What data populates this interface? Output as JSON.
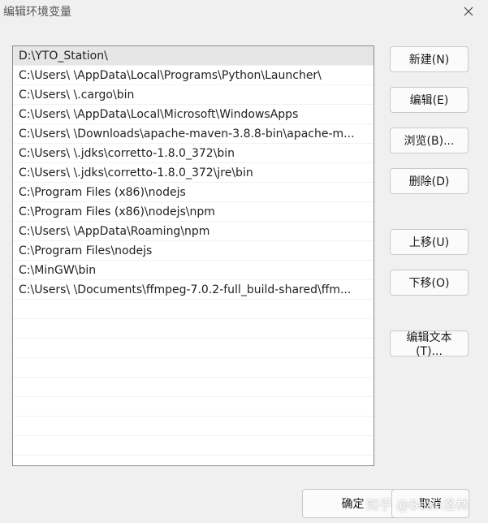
{
  "window": {
    "title": "编辑环境变量"
  },
  "paths": [
    "D:\\YTO_Station\\",
    "C:\\Users\\      \\AppData\\Local\\Programs\\Python\\Launcher\\",
    "C:\\Users\\        \\.cargo\\bin",
    "C:\\Users\\        \\AppData\\Local\\Microsoft\\WindowsApps",
    "C:\\Users\\      \\Downloads\\apache-maven-3.8.8-bin\\apache-m...",
    "C:\\Users\\        \\.jdks\\corretto-1.8.0_372\\bin",
    "C:\\Users\\        \\.jdks\\corretto-1.8.0_372\\jre\\bin",
    "C:\\Program Files (x86)\\nodejs",
    "C:\\Program Files (x86)\\nodejs\\npm",
    "C:\\Users\\        \\AppData\\Roaming\\npm",
    "C:\\Program Files\\nodejs",
    "C:\\MinGW\\bin",
    "C:\\Users\\            \\Documents\\ffmpeg-7.0.2-full_build-shared\\ffm..."
  ],
  "buttons": {
    "new": "新建(N)",
    "edit": "编辑(E)",
    "browse": "浏览(B)...",
    "delete": "删除(D)",
    "move_up": "上移(U)",
    "move_down": "下移(O)",
    "edit_text": "编辑文本(T)...",
    "ok": "确定",
    "cancel": "取消"
  },
  "watermark": "知乎 @Bean洛林"
}
